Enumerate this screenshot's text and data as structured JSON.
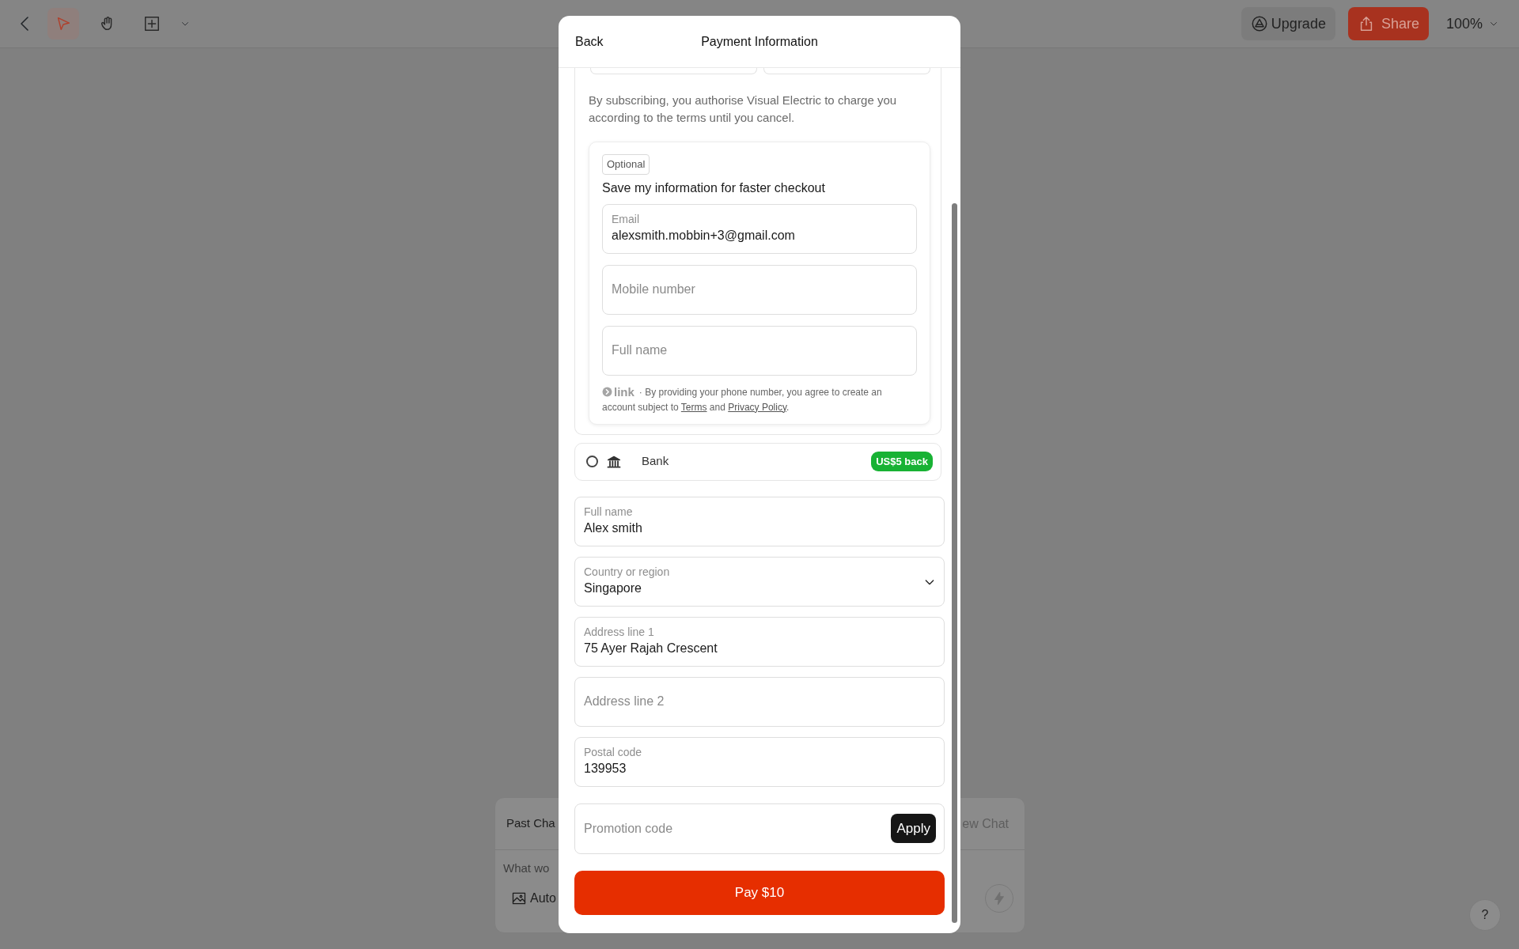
{
  "toolbar": {
    "tools": [
      {
        "kind": "pointer",
        "selected": true
      },
      {
        "kind": "hand",
        "selected": false
      },
      {
        "kind": "frame",
        "selected": false
      }
    ],
    "upgrade": "Upgrade",
    "share": "Share",
    "zoom": "100%"
  },
  "chat": {
    "tab": "Past Cha",
    "new_chat": "ew Chat",
    "placeholder": "What wo",
    "mode": "Auto"
  },
  "modal": {
    "back": "Back",
    "title": "Payment Information",
    "consent": "By subscribing, you authorise Visual Electric to charge you according to the terms until you cancel.",
    "save_box": {
      "badge": "Optional",
      "heading": "Save my information for faster checkout",
      "fields": [
        {
          "label": "Email",
          "value": "alexsmith.mobbin+3@gmail.com"
        },
        {
          "placeholder": "Mobile number"
        },
        {
          "placeholder": "Full name"
        }
      ],
      "brand": "link",
      "notice": "· By providing your phone number, you agree to create an",
      "notice_rest": "account subject to",
      "terms": "Terms",
      "joiner": "and",
      "privacy": "Privacy Policy",
      "end": "."
    },
    "methods": [
      {
        "kind": "bank",
        "label": "Bank",
        "selected": false,
        "badge": "US$5 back"
      }
    ],
    "billing": [
      {
        "kind": "text",
        "label": "Full name",
        "value": "Alex smith"
      },
      {
        "kind": "select",
        "label": "Country or region",
        "value": "Singapore"
      },
      {
        "kind": "text",
        "label": "Address line 1",
        "value": "75 Ayer Rajah Crescent"
      },
      {
        "kind": "text",
        "placeholder": "Address line 2"
      },
      {
        "kind": "text",
        "label": "Postal code",
        "value": "139953"
      }
    ],
    "promo": {
      "placeholder": "Promotion code",
      "button": "Apply"
    },
    "pay": "Pay $10"
  },
  "help": "?"
}
